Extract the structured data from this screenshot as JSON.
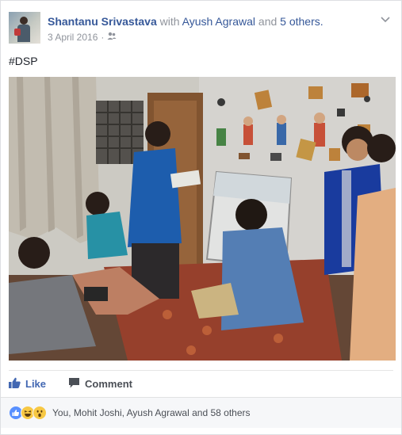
{
  "post": {
    "author": "Shantanu Srivastava",
    "with_word": "with",
    "friend": "Ayush Agrawal",
    "and_word": "and",
    "others": "5 others.",
    "date": "3 April 2016",
    "separator": "·",
    "audience_icon": "friends-icon",
    "options_icon": "chevron-down-icon",
    "text": "#DSP"
  },
  "actions": {
    "like_label": "Like",
    "like_icon": "thumbs-up-icon",
    "comment_label": "Comment",
    "comment_icon": "speech-bubble-icon"
  },
  "reactions": {
    "icons": [
      "like-reaction-icon",
      "haha-reaction-icon",
      "wow-reaction-icon"
    ],
    "summary": "You, Mohit Joshi, Ayush Agrawal and 58 others"
  },
  "colors": {
    "link": "#365899",
    "like_blue": "#4267b2",
    "meta_grey": "#90949c"
  }
}
